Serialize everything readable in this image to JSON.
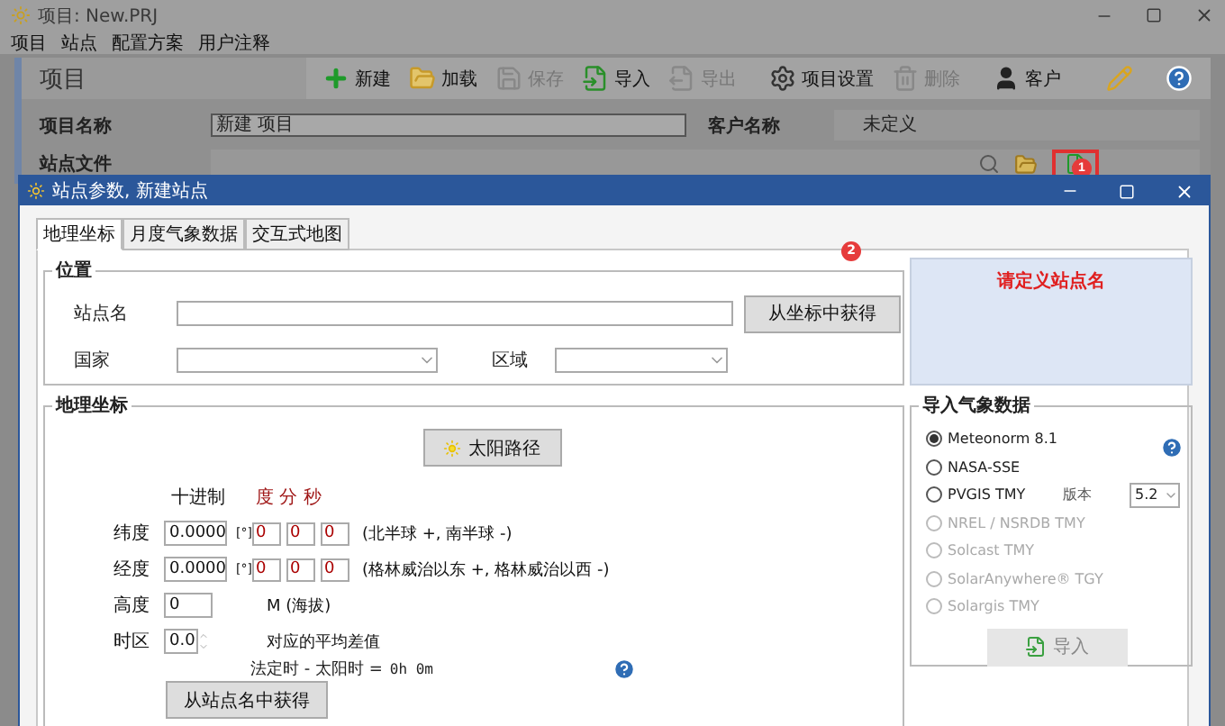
{
  "app": {
    "title": "项目: New.PRJ",
    "menu": [
      "项目",
      "站点",
      "配置方案",
      "用户注释"
    ],
    "panel_title": "项目",
    "toolbar": [
      {
        "kind": "new",
        "label": "新建",
        "disabled": false
      },
      {
        "kind": "open",
        "label": "加载",
        "disabled": false
      },
      {
        "kind": "save",
        "label": "保存",
        "disabled": true
      },
      {
        "kind": "import",
        "label": "导入",
        "disabled": false
      },
      {
        "kind": "export",
        "label": "导出",
        "disabled": true
      },
      {
        "kind": "settings",
        "label": "项目设置",
        "disabled": false
      },
      {
        "kind": "delete",
        "label": "删除",
        "disabled": true
      },
      {
        "kind": "client",
        "label": "客户",
        "disabled": false
      }
    ],
    "project_name_label": "项目名称",
    "project_name": "新建 项目",
    "client_label": "客户名称",
    "client_name": "未定义",
    "site_file_label": "站点文件",
    "site_badge": "1"
  },
  "dialog": {
    "title": "站点参数, 新建站点",
    "tabs": [
      {
        "label": "地理坐标",
        "selected": true
      },
      {
        "label": "月度气象数据",
        "selected": false
      },
      {
        "label": "交互式地图",
        "selected": false
      }
    ],
    "badge": "2",
    "location": {
      "legend": "位置",
      "site_label": "站点名",
      "get_button": "从坐标中获得",
      "country_label": "国家",
      "region_label": "区域"
    },
    "warning": "请定义站点名",
    "geo": {
      "legend": "地理坐标",
      "sun_button": "太阳路径",
      "decimal_header": "十进制",
      "dms_header": "度 分 秒",
      "rows": [
        {
          "label": "纬度",
          "value": "0.0000",
          "unit": "[°]",
          "deg": "0",
          "min": "0",
          "sec": "0",
          "note": "(北半球 +, 南半球 -)"
        },
        {
          "label": "经度",
          "value": "0.0000",
          "unit": "[°]",
          "deg": "0",
          "min": "0",
          "sec": "0",
          "note": "(格林威治以东 +, 格林威治以西 -)"
        }
      ],
      "altitude_label": "高度",
      "altitude": "0",
      "altitude_unit": "M (海拔)",
      "tz_label": "时区",
      "tz": "0.0",
      "tz_note": "对应的平均差值",
      "legal_label": "法定时 - 太阳时 =",
      "legal_value": "0h 0m",
      "from_name_button": "从站点名中获得"
    },
    "weather": {
      "legend": "导入气象数据",
      "version_label": "版本",
      "version": "5.2",
      "import_button": "导入",
      "sources": [
        {
          "label": "Meteonorm 8.1",
          "selected": true,
          "disabled": false
        },
        {
          "label": "NASA-SSE",
          "selected": false,
          "disabled": false
        },
        {
          "label": "PVGIS TMY",
          "selected": false,
          "disabled": false
        },
        {
          "label": "NREL / NSRDB TMY",
          "selected": false,
          "disabled": true
        },
        {
          "label": "Solcast TMY",
          "selected": false,
          "disabled": true
        },
        {
          "label": "SolarAnywhere® TGY",
          "selected": false,
          "disabled": true
        },
        {
          "label": "Solargis TMY",
          "selected": false,
          "disabled": true
        }
      ]
    }
  }
}
